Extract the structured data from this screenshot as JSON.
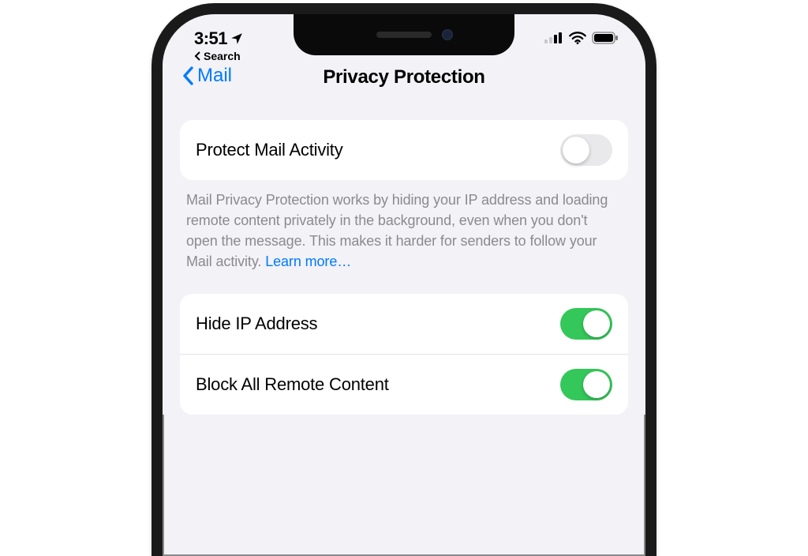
{
  "status": {
    "time": "3:51",
    "back_breadcrumb": "Search"
  },
  "nav": {
    "back_label": "Mail",
    "title": "Privacy Protection"
  },
  "settings": {
    "protect_mail": {
      "label": "Protect Mail Activity",
      "on": false,
      "description": "Mail Privacy Protection works by hiding your IP address and loading remote content privately in the background, even when you don't open the message. This makes it harder for senders to follow your Mail activity. ",
      "learn_more": "Learn more…"
    },
    "hide_ip": {
      "label": "Hide IP Address",
      "on": true
    },
    "block_remote": {
      "label": "Block All Remote Content",
      "on": true
    }
  }
}
